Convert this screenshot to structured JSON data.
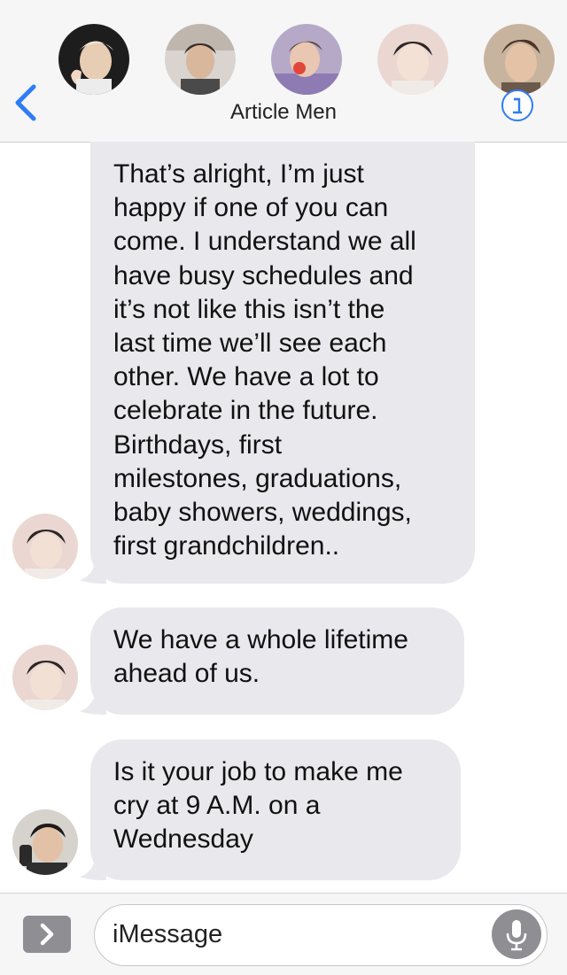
{
  "header": {
    "title": "Article Men",
    "back_icon": "chevron-left-icon",
    "info_icon": "info-icon",
    "accent": "#2f7cf6",
    "participants": [
      {
        "name": "participant-1"
      },
      {
        "name": "participant-2"
      },
      {
        "name": "participant-3"
      },
      {
        "name": "participant-4"
      },
      {
        "name": "participant-5"
      }
    ]
  },
  "messages": [
    {
      "text": "That’s alright, I’m just\nhappy if one of you can\ncome. I understand we all\nhave busy schedules and\nit’s not like this isn’t the\nlast time we’ll see each\nother. We have a lot to\ncelebrate in the future.\nBirthdays, first\nmilestones, graduations,\nbaby showers, weddings,\nfirst grandchildren.."
    },
    {
      "text": "We have a whole lifetime\nahead of us."
    },
    {
      "text": "Is it your job to make me\ncry at 9 A.M. on a\nWednesday"
    }
  ],
  "composer": {
    "placeholder": "iMessage",
    "expand_icon": "chevron-right-icon",
    "mic_icon": "microphone-icon"
  },
  "colors": {
    "bubble": "#e8e8ed",
    "bar": "#f6f6f7",
    "grey_button": "#8e8e93"
  }
}
